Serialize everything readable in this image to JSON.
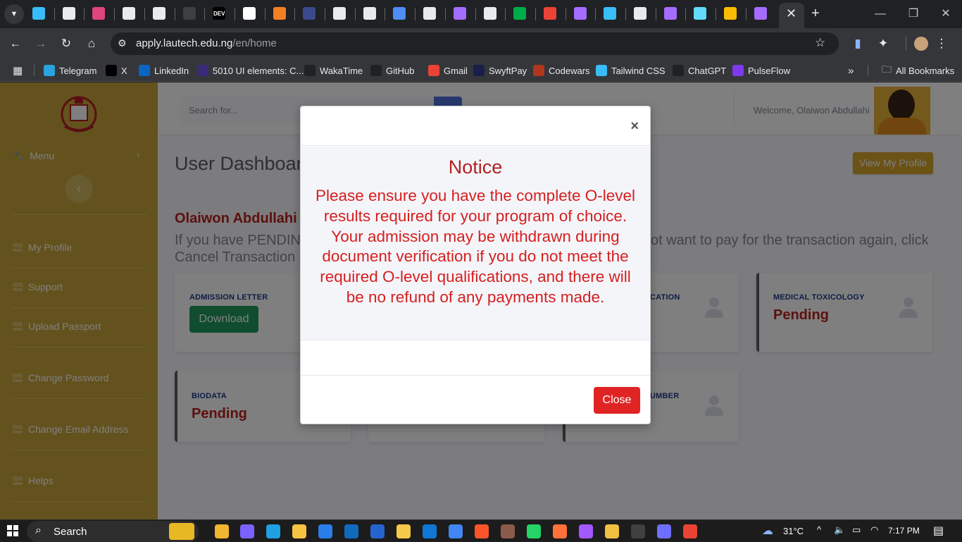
{
  "browser": {
    "url_host": "apply.lautech.edu.ng",
    "url_path": "/en/home",
    "tabs": [
      {
        "icon": "tailwind-icon",
        "color": "#38bdf8"
      },
      {
        "icon": "page-icon",
        "color": "#e8eaed"
      },
      {
        "icon": "react-icon",
        "color": "#e0457b"
      },
      {
        "icon": "page-icon",
        "color": "#e8eaed"
      },
      {
        "icon": "clock-icon",
        "color": "#e8eaed"
      },
      {
        "icon": "blank-icon",
        "color": "#3c4043"
      },
      {
        "icon": "dev-icon",
        "color": "#000000",
        "text": "DEV"
      },
      {
        "icon": "vercel-icon",
        "color": "#ffffff"
      },
      {
        "icon": "stackoverflow-icon",
        "color": "#f48024"
      },
      {
        "icon": "astro-icon",
        "color": "#3b4a8a"
      },
      {
        "icon": "chatgpt-icon",
        "color": "#e8eaed"
      },
      {
        "icon": "chatgpt-icon",
        "color": "#e8eaed"
      },
      {
        "icon": "gemini-icon",
        "color": "#4e8df5"
      },
      {
        "icon": "github-icon",
        "color": "#e8eaed"
      },
      {
        "icon": "vite-icon",
        "color": "#a46cff"
      },
      {
        "icon": "page-icon",
        "color": "#e8eaed"
      },
      {
        "icon": "meet-icon",
        "color": "#00ac47"
      },
      {
        "icon": "google-icon",
        "color": "#ea4335"
      },
      {
        "icon": "vite-icon",
        "color": "#a46cff"
      },
      {
        "icon": "tailwind-icon",
        "color": "#38bdf8"
      },
      {
        "icon": "page-icon",
        "color": "#e8eaed"
      },
      {
        "icon": "vite-icon",
        "color": "#a46cff"
      },
      {
        "icon": "react-icon",
        "color": "#61dafb"
      },
      {
        "icon": "drive-icon",
        "color": "#fbbc04"
      },
      {
        "icon": "vite-icon",
        "color": "#a46cff"
      }
    ]
  },
  "bookmarks": [
    {
      "label": "Telegram",
      "icon": "telegram-icon",
      "color": "#2aa3df"
    },
    {
      "label": "X",
      "icon": "x-icon",
      "color": "#000000"
    },
    {
      "label": "LinkedIn",
      "icon": "linkedin-icon",
      "color": "#0a66c2"
    },
    {
      "label": "5010 UI elements: C...",
      "icon": "uiverse-icon",
      "color": "#3b2a7a"
    },
    {
      "label": "WakaTime",
      "icon": "wakatime-icon",
      "color": "#202124"
    },
    {
      "label": "GitHub",
      "icon": "github-icon",
      "color": "#202124"
    },
    {
      "label": "Gmail",
      "icon": "gmail-icon",
      "color": "#ea4335"
    },
    {
      "label": "SwyftPay",
      "icon": "swyftpay-icon",
      "color": "#1a1f4a"
    },
    {
      "label": "Codewars",
      "icon": "codewars-icon",
      "color": "#b1361e"
    },
    {
      "label": "Tailwind CSS",
      "icon": "tailwind-icon",
      "color": "#38bdf8"
    },
    {
      "label": "ChatGPT",
      "icon": "chatgpt-icon",
      "color": "#202124"
    },
    {
      "label": "PulseFlow",
      "icon": "pulseflow-icon",
      "color": "#7c3aed"
    }
  ],
  "all_bookmarks_label": "All Bookmarks",
  "app": {
    "search_placeholder": "Search for...",
    "welcome": "Welcome, Olaiwon Abdullahi",
    "sidebar": {
      "menu_label": "Menu",
      "items": [
        "My Profile",
        "Support",
        "Upload Passport",
        "Change Password",
        "Change Email Address",
        "Helps"
      ]
    },
    "page_title": "User Dashboard",
    "view_profile_button": "View My Profile",
    "user_name": "Olaiwon Abdullahi",
    "notice_line1_start": "If you have PENDING",
    "notice_line1_end": "ot want to pay for the transaction again, click",
    "notice_line2_start": "Cancel Transaction s",
    "cards": {
      "admission_letter": {
        "label": "ADMISSION LETTER",
        "button": "Download"
      },
      "card2_label_fragment": "CATION",
      "medical_toxicology": {
        "label": "MEDICAL TOXICOLOGY",
        "status": "Pending"
      },
      "biodata": {
        "label": "BIODATA",
        "status": "Pending"
      },
      "card6_label_fragment": "UMBER"
    },
    "colors": {
      "sidebar": "#c7a43a",
      "primary": "#4e73df",
      "success": "#1e9a5c",
      "danger": "#c0392b"
    }
  },
  "modal": {
    "title": "Notice",
    "message": "Please ensure you have the complete O-level results required for your program of choice. Your admission may be withdrawn during document verification if you do not meet the required O-level qualifications, and there will be no refund of any payments made.",
    "close_icon": "×",
    "close_button": "Close"
  },
  "taskbar": {
    "search_label": "Search",
    "weather": "31°C",
    "time": "7:17 PM"
  }
}
